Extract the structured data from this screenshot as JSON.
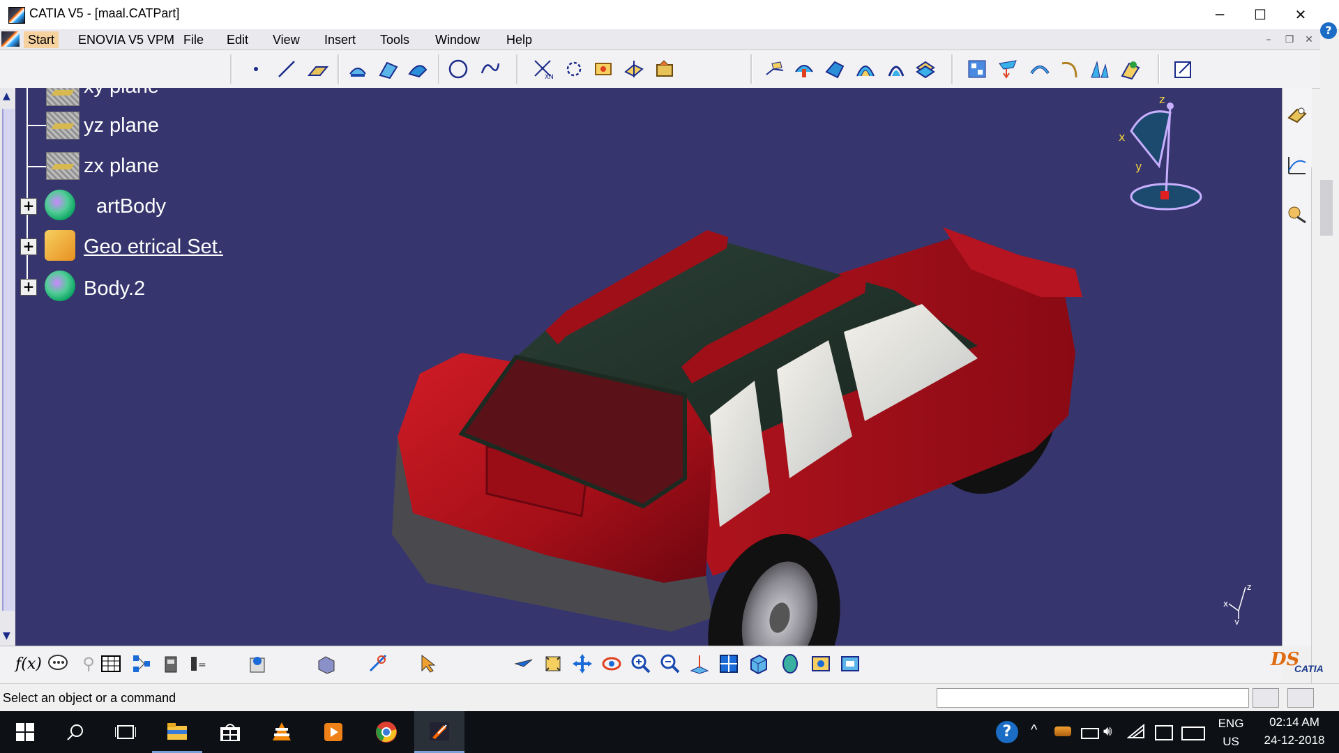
{
  "window": {
    "title": "CATIA V5 - [maal.CATPart]",
    "minimize_glyph": "─",
    "maximize_glyph": "☐",
    "close_glyph": "✕"
  },
  "menu": {
    "items": [
      "Start",
      "ENOVIA V5 VPM",
      "File",
      "Edit",
      "View",
      "Insert",
      "Tools",
      "Window",
      "Help"
    ]
  },
  "tree": {
    "items": [
      {
        "label": "xy plane",
        "icon": "plane-icon"
      },
      {
        "label": "yz plane",
        "icon": "plane-icon"
      },
      {
        "label": "zx plane",
        "icon": "plane-icon"
      },
      {
        "label": "artBody",
        "icon": "part-body-icon"
      },
      {
        "label": "Geo   etrical Set.",
        "icon": "geometrical-set-icon"
      },
      {
        "label": "Body.2",
        "icon": "body-icon"
      }
    ]
  },
  "compass": {
    "x_label": "x",
    "y_label": "y",
    "z_label": "z"
  },
  "axis_triad": {
    "x_label": "x",
    "y_label": "y",
    "z_label": "z"
  },
  "status": {
    "prompt": "Select an object or a command"
  },
  "brand": {
    "logo_text": "CATIA"
  },
  "taskbar": {
    "language_top": "ENG",
    "language_bottom": "US",
    "time": "02:14 AM",
    "date": "24-12-2018"
  },
  "colors": {
    "viewport_bg": "#36356e",
    "car_body": "#a0101a",
    "car_roof": "#22332c",
    "taskbar": "#0d1115"
  }
}
